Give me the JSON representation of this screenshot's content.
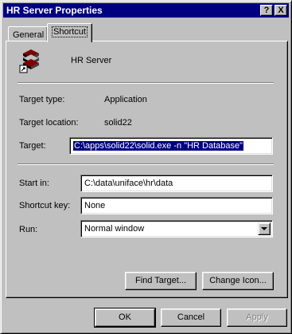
{
  "window": {
    "title": "HR Server Properties",
    "help_label": "?",
    "close_label": "X"
  },
  "tabs": [
    {
      "label": "General",
      "active": false
    },
    {
      "label": "Shortcut",
      "active": true
    }
  ],
  "shortcut": {
    "name": "HR Server",
    "icon": "app-shortcut-icon",
    "target_type_label": "Target type:",
    "target_type_value": "Application",
    "target_location_label": "Target location:",
    "target_location_value": "solid22",
    "target_label": "Target:",
    "target_value": "C:\\apps\\solid22\\solid.exe -n \"HR Database\"",
    "start_in_label": "Start in:",
    "start_in_value": "C:\\data\\uniface\\hr\\data",
    "shortcut_key_label": "Shortcut key:",
    "shortcut_key_value": "None",
    "run_label": "Run:",
    "run_value": "Normal window"
  },
  "buttons": {
    "find_target": "Find Target...",
    "change_icon": "Change Icon...",
    "ok": "OK",
    "cancel": "Cancel",
    "apply": "Apply"
  },
  "colors": {
    "titlebar": "#000080",
    "face": "#c0c0c0",
    "selection": "#000080"
  }
}
